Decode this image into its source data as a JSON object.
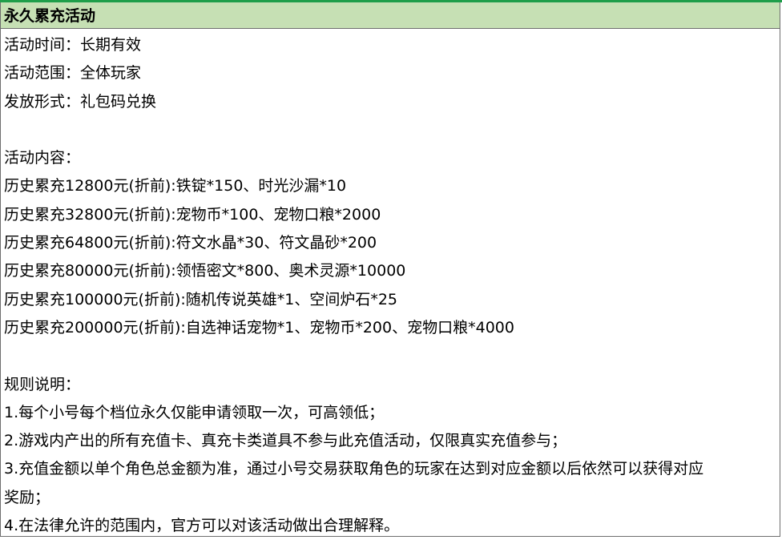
{
  "header": {
    "title": "永久累充活动"
  },
  "info": {
    "time": "活动时间：长期有效",
    "scope": "活动范围：全体玩家",
    "form": "发放形式：礼包码兑换"
  },
  "rewards": {
    "heading": "活动内容：",
    "tiers": [
      "历史累充12800元(折前):铁锭*150、时光沙漏*10",
      "历史累充32800元(折前):宠物币*100、宠物口粮*2000",
      "历史累充64800元(折前):符文水晶*30、符文晶砂*200",
      "历史累充80000元(折前):领悟密文*800、奥术灵源*10000",
      "历史累充100000元(折前):随机传说英雄*1、空间炉石*25",
      "历史累充200000元(折前):自选神话宠物*1、宠物币*200、宠物口粮*4000"
    ]
  },
  "rules": {
    "heading": "规则说明：",
    "items": [
      "1.每个小号每个档位永久仅能申请领取一次，可高领低；",
      "2.游戏内产出的所有充值卡、真充卡类道具不参与此充值活动，仅限真实充值参与；",
      "3.充值金额以单个角色总金额为准，通过小号交易获取角色的玩家在达到对应金额以后依然可以获得对应",
      "奖励；",
      "4.在法律允许的范围内，官方可以对该活动做出合理解释。"
    ]
  }
}
